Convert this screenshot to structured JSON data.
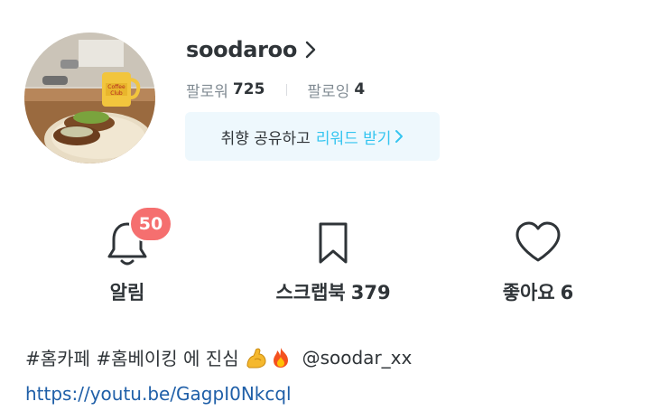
{
  "profile": {
    "username": "soodaroo",
    "followers_label": "팔로워",
    "followers_count": "725",
    "following_label": "팔로잉",
    "following_count": "4"
  },
  "reward_banner": {
    "text": "취향 공유하고",
    "link_text": "리워드 받기"
  },
  "stats": {
    "notifications_label": "알림",
    "notifications_badge": "50",
    "scrapbook_label": "스크랩북",
    "scrapbook_count": "379",
    "likes_label": "좋아요",
    "likes_count": "6"
  },
  "bio": {
    "text": "#홈카페 #홈베이킹 에 진심",
    "emojis": [
      "flexed-biceps-icon",
      "fire-icon"
    ],
    "handle": "@soodar_xx",
    "link": "https://youtu.be/GagpI0Nkcql"
  },
  "colors": {
    "accent": "#35c5f0",
    "badge": "#f56f6f",
    "banner_bg": "#eef8fd",
    "link": "#1f5fa8"
  }
}
